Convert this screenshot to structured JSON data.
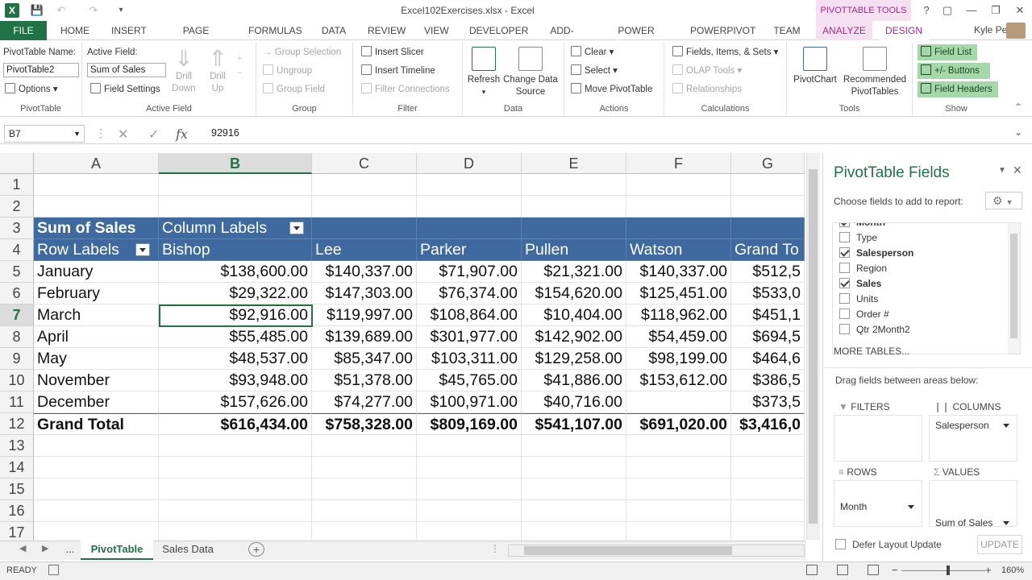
{
  "window": {
    "title": "Excel102Exercises.xlsx - Excel",
    "context_header": "PIVOTTABLE TOOLS",
    "user": "Kyle Pew",
    "help": "?"
  },
  "tabs": [
    "FILE",
    "HOME",
    "INSERT",
    "PAGE LAYOUT",
    "FORMULAS",
    "DATA",
    "REVIEW",
    "VIEW",
    "DEVELOPER",
    "ADD-INS",
    "POWER QUERY",
    "POWERPIVOT",
    "TEAM",
    "ANALYZE",
    "DESIGN"
  ],
  "ribbon": {
    "pivottable": {
      "name_label": "PivotTable Name:",
      "name_value": "PivotTable2",
      "options": "Options",
      "group": "PivotTable"
    },
    "active_field": {
      "label": "Active Field:",
      "value": "Sum of Sales",
      "settings": "Field Settings",
      "drill_down": "Drill Down",
      "drill_up": "Drill Up",
      "group": "Active Field"
    },
    "group": {
      "selection": "Group Selection",
      "ungroup": "Ungroup",
      "field": "Group Field",
      "group": "Group"
    },
    "filter": {
      "slicer": "Insert Slicer",
      "timeline": "Insert Timeline",
      "connections": "Filter Connections",
      "group": "Filter"
    },
    "data": {
      "refresh": "Refresh",
      "change_source": "Change Data Source",
      "group": "Data"
    },
    "actions": {
      "clear": "Clear",
      "select": "Select",
      "move": "Move PivotTable",
      "group": "Actions"
    },
    "calculations": {
      "fields": "Fields, Items, & Sets",
      "olap": "OLAP Tools",
      "relationships": "Relationships",
      "group": "Calculations"
    },
    "tools": {
      "pivotchart": "PivotChart",
      "recommended": "Recommended PivotTables",
      "group": "Tools"
    },
    "show": {
      "field_list": "Field List",
      "buttons": "+/- Buttons",
      "field_headers": "Field Headers",
      "group": "Show"
    }
  },
  "formula_bar": {
    "name_box": "B7",
    "value": "92916",
    "fx": "fx"
  },
  "grid": {
    "columns": [
      "A",
      "B",
      "C",
      "D",
      "E",
      "F",
      "G"
    ],
    "rows": [
      "1",
      "2",
      "3",
      "4",
      "5",
      "6",
      "7",
      "8",
      "9",
      "10",
      "11",
      "12",
      "13",
      "14",
      "15",
      "16",
      "17"
    ],
    "pivot": {
      "sum_label": "Sum of Sales",
      "col_labels": "Column Labels",
      "row_labels": "Row Labels",
      "headers": [
        "Bishop",
        "Lee",
        "Parker",
        "Pullen",
        "Watson",
        "Grand To"
      ],
      "data": [
        [
          "January",
          "$138,600.00",
          "$140,337.00",
          "$71,907.00",
          "$21,321.00",
          "$140,337.00",
          "$512,5"
        ],
        [
          "February",
          "$29,322.00",
          "$147,303.00",
          "$76,374.00",
          "$154,620.00",
          "$125,451.00",
          "$533,0"
        ],
        [
          "March",
          "$92,916.00",
          "$119,997.00",
          "$108,864.00",
          "$10,404.00",
          "$118,962.00",
          "$451,1"
        ],
        [
          "April",
          "$55,485.00",
          "$139,689.00",
          "$301,977.00",
          "$142,902.00",
          "$54,459.00",
          "$694,5"
        ],
        [
          "May",
          "$48,537.00",
          "$85,347.00",
          "$103,311.00",
          "$129,258.00",
          "$98,199.00",
          "$464,6"
        ],
        [
          "November",
          "$93,948.00",
          "$51,378.00",
          "$45,765.00",
          "$41,886.00",
          "$153,612.00",
          "$386,5"
        ],
        [
          "December",
          "$157,626.00",
          "$74,277.00",
          "$100,971.00",
          "$40,716.00",
          "",
          "$373,5"
        ],
        [
          "Grand Total",
          "$616,434.00",
          "$758,328.00",
          "$809,169.00",
          "$541,107.00",
          "$691,020.00",
          "$3,416,0"
        ]
      ]
    }
  },
  "sheets": {
    "more": "...",
    "tabs": [
      "PivotTable",
      "Sales Data"
    ],
    "add": "+"
  },
  "status": {
    "ready": "READY",
    "zoom": "160%"
  },
  "pane": {
    "title": "PivotTable Fields",
    "choose": "Choose fields to add to report:",
    "fields": [
      {
        "name": "Month",
        "checked": true
      },
      {
        "name": "Type",
        "checked": false
      },
      {
        "name": "Salesperson",
        "checked": true
      },
      {
        "name": "Region",
        "checked": false
      },
      {
        "name": "Sales",
        "checked": true
      },
      {
        "name": "Units",
        "checked": false
      },
      {
        "name": "Order #",
        "checked": false
      },
      {
        "name": "Qtr 2Month2",
        "checked": false
      }
    ],
    "more_tables": "MORE TABLES...",
    "drag": "Drag fields between areas below:",
    "filters": "FILTERS",
    "columns": "COLUMNS",
    "columns_value": "Salesperson",
    "rows": "ROWS",
    "rows_value": "Month",
    "values": "VALUES",
    "values_value": "Sum of Sales",
    "defer": "Defer Layout Update",
    "update": "UPDATE"
  }
}
